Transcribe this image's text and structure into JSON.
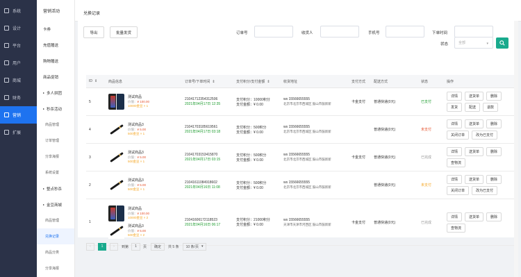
{
  "sidebar": {
    "items": [
      {
        "label": "系统"
      },
      {
        "label": "设计"
      },
      {
        "label": "平台"
      },
      {
        "label": "用户"
      },
      {
        "label": "商城"
      },
      {
        "label": "财务"
      },
      {
        "label": "营销"
      },
      {
        "label": "扩展"
      }
    ]
  },
  "submenu": {
    "title": "营销活动",
    "items": [
      "卡券",
      "充值赠送",
      "购物赠送",
      "商品促销"
    ],
    "groups": [
      {
        "label": "多人拼团",
        "items": []
      },
      {
        "label": "秒杀活动",
        "items": [
          "商品管理",
          "订单管理",
          "分享海报",
          "系统设置"
        ]
      },
      {
        "label": "整点秒杀",
        "items": []
      },
      {
        "label": "金豆商城",
        "items": [
          "商品管理",
          "兑换记录",
          "商品分类",
          "分享海报"
        ]
      }
    ]
  },
  "page": {
    "title": "兑换记录"
  },
  "toolbar": {
    "export": "导出",
    "batch_ship": "批量发货"
  },
  "filters": {
    "order_no": "订单号",
    "receiver": "收货人",
    "phone": "手机号",
    "order_time": "下单时间",
    "status": "状态",
    "status_value": "全部"
  },
  "table": {
    "headers": [
      "ID",
      "商品信息",
      "订单号/下单时间",
      "支付积分/支付金额",
      "收货地址",
      "支付方式",
      "配送方式",
      "状态",
      "操作"
    ],
    "sort_arrow": "⇕",
    "labels": {
      "price": "价值：",
      "points_paid": "支付积分：",
      "amount_paid": "支付金额："
    },
    "rows": [
      {
        "id": "5",
        "products": [
          {
            "img": "phone-icon",
            "name": "测试商品",
            "price": "¥ 100.00",
            "points": "10000金豆 × 1"
          }
        ],
        "order_no": "210417123543125​06",
        "time": "2021年04月17日 12:35",
        "pay_points": "10000积分",
        "pay_amount": "¥ 0.00",
        "addr_name": "ws 15566655555",
        "addr": "北京市北京市西城区 鼓山市鼓新新",
        "pay_method": "卡金支付",
        "delivery": "普通快递(0元)",
        "status": "已支付",
        "status_color": "#1a9b2c",
        "ops": [
          "详情",
          "送货单",
          "删除",
          "发货",
          "配送",
          "退款"
        ]
      },
      {
        "id": "4",
        "products": [
          {
            "img": "pen-icon",
            "name": "测试商品3",
            "price": "¥ 5.00",
            "points": "500金豆 × 1"
          }
        ],
        "order_no": "21041703185619561",
        "time": "2021年04月17日 03:18",
        "pay_points": "500积分",
        "pay_amount": "¥ 0.00",
        "addr_name": "ws 15566655555",
        "addr": "北京市北京市西城区 鼓山市鼓新新",
        "pay_method": "",
        "delivery": "普通快递(0元)",
        "status": "未支付",
        "status_color": "#e5532d",
        "ops": [
          "详情",
          "送货单",
          "删除",
          "关闭订单",
          "改为已支付"
        ]
      },
      {
        "id": "3",
        "products": [
          {
            "img": "pen-icon",
            "name": "测试商品3",
            "price": "¥ 5.00",
            "points": "500金豆 × 1"
          }
        ],
        "order_no": "21041703153415870",
        "time": "2021年04月17日 03:15",
        "pay_points": "500积分",
        "pay_amount": "¥ 0.00",
        "addr_name": "ws 15566655555",
        "addr": "北京市北京市西城区 鼓山市鼓新新",
        "pay_method": "卡金支付",
        "delivery": "普通快递(0元)",
        "status": "已完成",
        "status_color": "#999999",
        "ops": [
          "详情",
          "送货单",
          "删除",
          "查物流"
        ]
      },
      {
        "id": "2",
        "products": [
          {
            "img": "pen-icon",
            "name": "测试商品3",
            "price": "¥ 5.00",
            "points": "500金豆 × 1"
          }
        ],
        "order_no": "21041611084918602",
        "time": "2021年04月16日 11:08",
        "pay_points": "500积分",
        "pay_amount": "¥ 0.00",
        "addr_name": "ws 15566655555",
        "addr": "北京市北京市西城区 鼓山市鼓新新",
        "pay_method": "",
        "delivery": "普通快递(0元)",
        "status": "未支付",
        "status_color": "#f5a623",
        "ops": [
          "详情",
          "送货单",
          "删除",
          "关闭订单",
          "改为已支付"
        ]
      },
      {
        "id": "1",
        "products": [
          {
            "img": "phone-icon",
            "name": "测试商品",
            "price": "¥ 100.00",
            "points": "10000金豆 × 2"
          },
          {
            "img": "pen-icon",
            "name": "测试商品3",
            "price": "¥ 5.00",
            "points": "500金豆 × 2"
          }
        ],
        "order_no": "21041606172118523",
        "time": "2021年04月16日 06:17",
        "pay_points": "21000积分",
        "pay_amount": "¥ 0.00",
        "addr_name": "ws 15566655555",
        "addr": "天津市天津市河西区 鼓山市鼓新新",
        "pay_method": "卡金支付",
        "delivery": "普通快递(0元)",
        "status": "已完成",
        "status_color": "#999999",
        "ops": [
          "详情",
          "送货单",
          "删除",
          "查物流"
        ]
      }
    ]
  },
  "pager": {
    "prev": "‹",
    "current": "1",
    "next": "›",
    "goto": "到第",
    "input": "1",
    "page_unit": "页",
    "confirm": "确定",
    "total": "共 5 条",
    "size": "10 条/页"
  },
  "colors": {
    "accent": "#19aa8d",
    "sidebar_bg": "#2b3248",
    "active": "#1e73f0"
  }
}
